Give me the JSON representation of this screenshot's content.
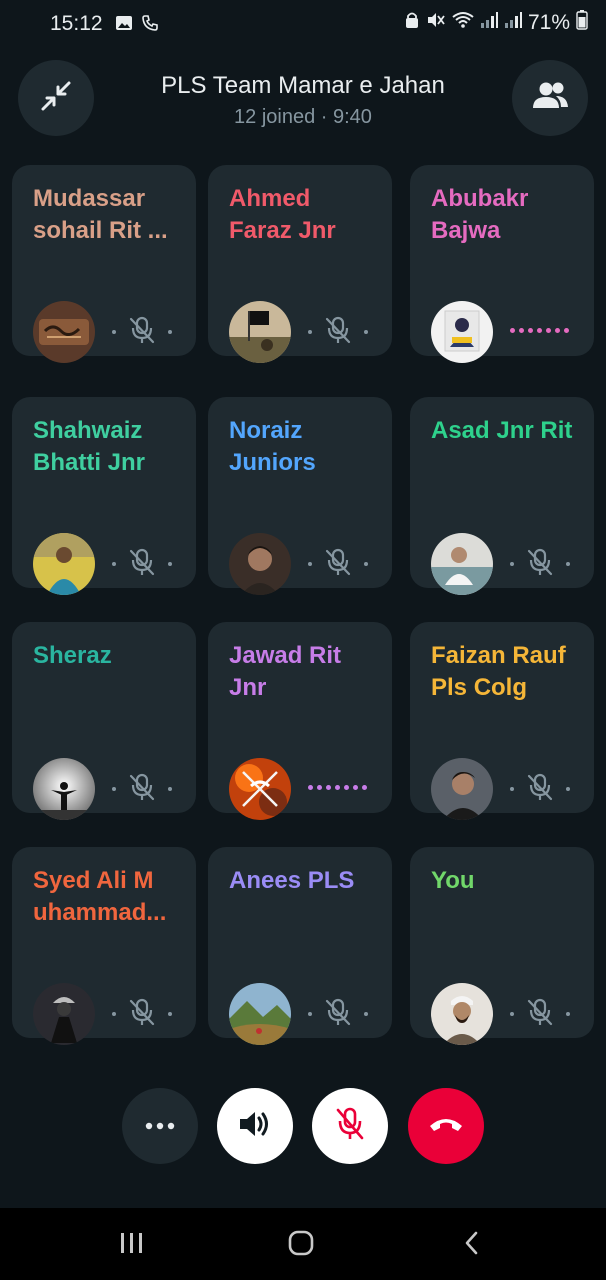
{
  "status_bar": {
    "time": "15:12",
    "battery": "71%"
  },
  "call": {
    "title": "PLS Team Mamar e Jahan",
    "meta": "12 joined · 9:40"
  },
  "participants": [
    {
      "name": "Mudassar sohail Rit ...",
      "color": "#d9a088",
      "avatar": "calligraphy",
      "status": "muted"
    },
    {
      "name": "Ahmed Faraz Jnr",
      "color": "#f05a6a",
      "avatar": "flag",
      "status": "muted"
    },
    {
      "name": "Abubakr Bajwa",
      "color": "#e56bc0",
      "avatar": "person-frame",
      "status": "speaking",
      "speaking_color": "#e56bc0"
    },
    {
      "name": "Shahwaiz Bhatti Jnr",
      "color": "#3fcfa0",
      "avatar": "person-outdoor",
      "status": "muted"
    },
    {
      "name": "Noraiz Juniors",
      "color": "#53a6fd",
      "avatar": "person-portrait",
      "status": "muted"
    },
    {
      "name": "Asad Jnr Rit",
      "color": "#2ed18c",
      "avatar": "person-white",
      "status": "muted"
    },
    {
      "name": "Sheraz",
      "color": "#2ab5a0",
      "avatar": "silhouette",
      "status": "muted"
    },
    {
      "name": "Jawad Rit Jnr",
      "color": "#c77de8",
      "avatar": "fire-swords",
      "status": "speaking",
      "speaking_color": "#c77de8"
    },
    {
      "name": "Faizan Rauf Pls Colg",
      "color": "#f5b638",
      "avatar": "person-dark",
      "status": "muted"
    },
    {
      "name": "Syed Ali M uhammad...",
      "color": "#f0663e",
      "avatar": "person-hat",
      "status": "muted"
    },
    {
      "name": "Anees PLS",
      "color": "#9a8cf5",
      "avatar": "landscape",
      "status": "muted"
    },
    {
      "name": "You",
      "color": "#71d76a",
      "avatar": "person-you",
      "status": "muted"
    }
  ],
  "controls": {
    "more": "more-options",
    "speaker": "speaker",
    "mute": "microphone-muted",
    "end": "end-call"
  },
  "colors": {
    "background": "#0e161b",
    "tile": "#1f2a30",
    "end_call": "#ea0038",
    "muted_text": "#8696a0"
  }
}
